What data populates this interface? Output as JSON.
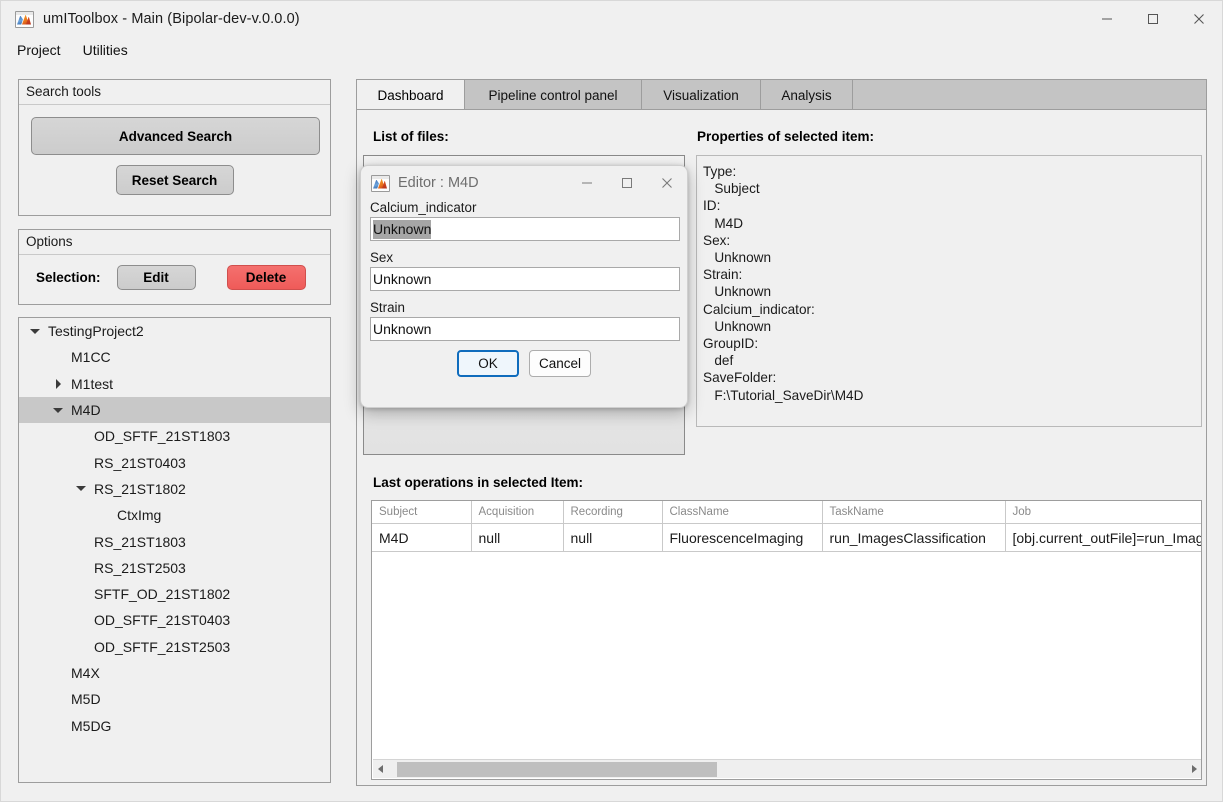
{
  "window": {
    "title": "umIToolbox - Main  (Bipolar-dev-v.0.0.0)",
    "icon": "matlab-icon",
    "minimize": "—",
    "maximize": "□",
    "close": "×"
  },
  "menubar": {
    "items": [
      {
        "label": "Project"
      },
      {
        "label": "Utilities"
      }
    ]
  },
  "search_panel": {
    "title": "Search tools",
    "advanced_search": "Advanced Search",
    "reset_search": "Reset Search"
  },
  "options_panel": {
    "title": "Options",
    "selection_label": "Selection:",
    "edit": "Edit",
    "delete": "Delete",
    "delete_color": "#ef5b59"
  },
  "tree": {
    "selected": "M4D",
    "selection_color": "#c8c8c8",
    "items": [
      {
        "label": "TestingProject2",
        "depth": 0,
        "toggle": "down",
        "selected": false
      },
      {
        "label": "M1CC",
        "depth": 1,
        "toggle": "none",
        "selected": false
      },
      {
        "label": "M1test",
        "depth": 1,
        "toggle": "right",
        "selected": false
      },
      {
        "label": "M4D",
        "depth": 1,
        "toggle": "down",
        "selected": true
      },
      {
        "label": "OD_SFTF_21ST1803",
        "depth": 2,
        "toggle": "none",
        "selected": false
      },
      {
        "label": "RS_21ST0403",
        "depth": 2,
        "toggle": "none",
        "selected": false
      },
      {
        "label": "RS_21ST1802",
        "depth": 2,
        "toggle": "down",
        "selected": false
      },
      {
        "label": "CtxImg",
        "depth": 3,
        "toggle": "none",
        "selected": false
      },
      {
        "label": "RS_21ST1803",
        "depth": 2,
        "toggle": "none",
        "selected": false
      },
      {
        "label": "RS_21ST2503",
        "depth": 2,
        "toggle": "none",
        "selected": false
      },
      {
        "label": "SFTF_OD_21ST1802",
        "depth": 2,
        "toggle": "none",
        "selected": false
      },
      {
        "label": "OD_SFTF_21ST0403",
        "depth": 2,
        "toggle": "none",
        "selected": false
      },
      {
        "label": "OD_SFTF_21ST2503",
        "depth": 2,
        "toggle": "none",
        "selected": false
      },
      {
        "label": "M4X",
        "depth": 1,
        "toggle": "none",
        "selected": false
      },
      {
        "label": "M5D",
        "depth": 1,
        "toggle": "none",
        "selected": false
      },
      {
        "label": "M5DG",
        "depth": 1,
        "toggle": "none",
        "selected": false
      }
    ]
  },
  "tabs": {
    "active": "Dashboard",
    "items": [
      {
        "label": "Dashboard"
      },
      {
        "label": "Pipeline control panel"
      },
      {
        "label": "Visualization"
      },
      {
        "label": "Analysis"
      }
    ]
  },
  "dashboard": {
    "files_label": "List of files:",
    "properties_label": "Properties of selected item:",
    "operations_label": "Last operations in selected Item:",
    "properties": [
      "Type:",
      "   Subject",
      "ID:",
      "   M4D",
      "Sex:",
      "   Unknown",
      "Strain:",
      "   Unknown",
      "Calcium_indicator:",
      "   Unknown",
      "GroupID:",
      "   def",
      "SaveFolder:",
      "   F:\\Tutorial_SaveDir\\M4D"
    ],
    "table": {
      "columns": [
        "Subject",
        "Acquisition",
        "Recording",
        "ClassName",
        "TaskName",
        "Job"
      ],
      "rows": [
        [
          "M4D",
          "null",
          "null",
          "FluorescenceImaging",
          "run_ImagesClassification",
          "[obj.current_outFile]=run_Imag"
        ]
      ]
    },
    "scrollbar": {
      "left_arrow": "◀",
      "right_arrow": "▶"
    }
  },
  "editor_dialog": {
    "title": "Editor : M4D",
    "icon": "matlab-icon",
    "minimize": "—",
    "maximize": "□",
    "close": "×",
    "fields": [
      {
        "label": "Calcium_indicator",
        "value": "Unknown",
        "selected": true
      },
      {
        "label": "Sex",
        "value": "Unknown",
        "selected": false
      },
      {
        "label": "Strain",
        "value": "Unknown",
        "selected": false
      }
    ],
    "ok": "OK",
    "cancel": "Cancel",
    "focus_color": "#0f6cbd"
  }
}
